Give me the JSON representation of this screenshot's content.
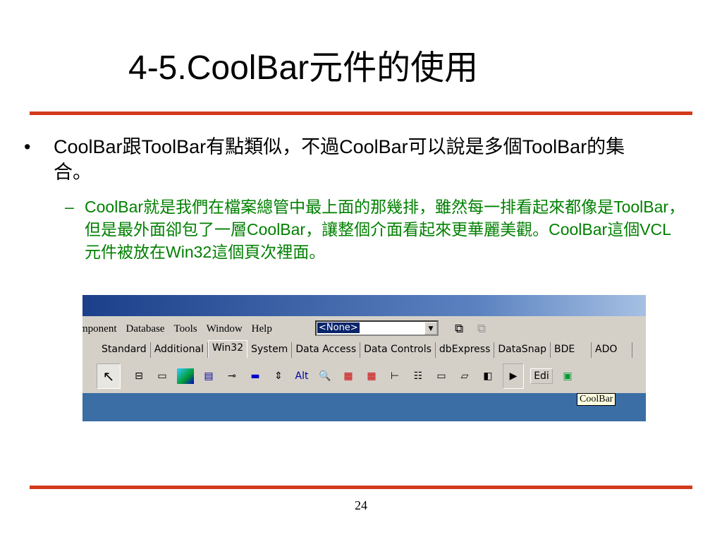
{
  "title": "4-5.CoolBar元件的使用",
  "bullet1": {
    "marker": "•",
    "text": "CoolBar跟ToolBar有點類似，不過CoolBar可以說是多個ToolBar的集合。"
  },
  "bullet2": {
    "marker": "–",
    "text": "CoolBar就是我們在檔案總管中最上面的那幾排，雖然每一排看起來都像是ToolBar，但是最外面卻包了一層CoolBar，讓整個介面看起來更華麗美觀。CoolBar這個VCL元件被放在Win32這個頁次裡面。"
  },
  "screenshot": {
    "menu": [
      "mponent",
      "Database",
      "Tools",
      "Window",
      "Help"
    ],
    "combo_value": "<None>",
    "tabs": [
      "Standard",
      "Additional",
      "Win32",
      "System",
      "Data Access",
      "Data Controls",
      "dbExpress",
      "DataSnap",
      "BDE",
      "ADO"
    ],
    "active_tab": "Win32",
    "tooltip": "CoolBar",
    "edit_button": "Edi"
  },
  "page_number": "24",
  "colors": {
    "rule": "#d23a1a",
    "sub_text": "#008000"
  }
}
